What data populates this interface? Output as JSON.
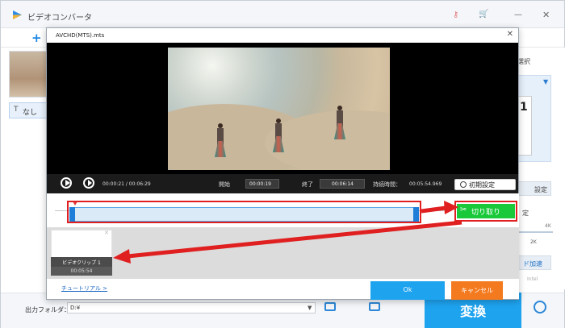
{
  "app": {
    "title": "ビデオコンバータ",
    "add_label": "+",
    "subtitle_value": "なし",
    "subtitle_icon": "T",
    "format_label": "選択",
    "format_number": "1",
    "settings_label": "設定",
    "resolution_label": "定",
    "res_4k": "4K",
    "res_2k": "2K",
    "gpu_label": "ド加速",
    "intel_label": "Intel",
    "output_folder_label": "出力フォルダ：",
    "output_folder_value": "D:¥",
    "convert_label": "変換"
  },
  "dialog": {
    "title": "AVCHD(MTS).mts",
    "time_current": "00:00:21 / 00:06:29",
    "start_label": "開始",
    "start_value": "00:00:19",
    "end_label": "終了",
    "end_value": "00:06:14",
    "duration_label": "持続時間：",
    "duration_value": "00:05:54.969",
    "reset_label": "初期設定",
    "cut_label": "切り取り",
    "clip_name": "ビデオクリップ 1",
    "clip_duration": "00:05:54",
    "tutorial_link": "チュートリアル >",
    "ok_label": "Ok",
    "cancel_label": "キャンセル"
  },
  "colors": {
    "accent_blue": "#1ea3ef",
    "cut_green": "#19c93a",
    "cancel_orange": "#f47a1f",
    "highlight_red": "#e02020"
  }
}
